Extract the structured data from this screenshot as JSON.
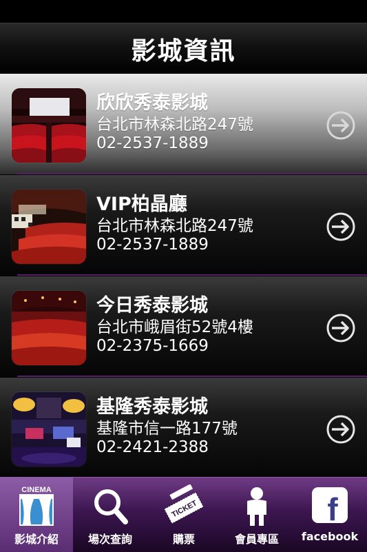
{
  "header": {
    "title": "影城資訊"
  },
  "cinemas": [
    {
      "name": "欣欣秀泰影城",
      "address": "台北市林森北路247號",
      "phone": "02-2537-1889",
      "selected": true
    },
    {
      "name": "VIP柏晶廳",
      "address": "台北市林森北路247號",
      "phone": "02-2537-1889",
      "selected": false
    },
    {
      "name": "今日秀泰影城",
      "address": "台北市峨眉街52號4樓",
      "phone": "02-2375-1669",
      "selected": false
    },
    {
      "name": "基隆秀泰影城",
      "address": "基隆市信一路177號",
      "phone": "02-2421-2388",
      "selected": false
    }
  ],
  "tabs": [
    {
      "label": "影城介紹",
      "icon": "cinema-curtain-icon",
      "icon_text": "CINEMA",
      "active": true
    },
    {
      "label": "場次查詢",
      "icon": "magnifier-icon",
      "active": false
    },
    {
      "label": "購票",
      "icon": "ticket-icon",
      "icon_text": "TICKET",
      "active": false
    },
    {
      "label": "會員專區",
      "icon": "member-icon",
      "active": false
    },
    {
      "label": "facebook",
      "icon": "facebook-icon",
      "icon_text": "f",
      "active": false
    }
  ],
  "colors": {
    "divider": "#5b1e6a",
    "tabbar": "#3c1650",
    "tab_active": "#8c5da6"
  }
}
